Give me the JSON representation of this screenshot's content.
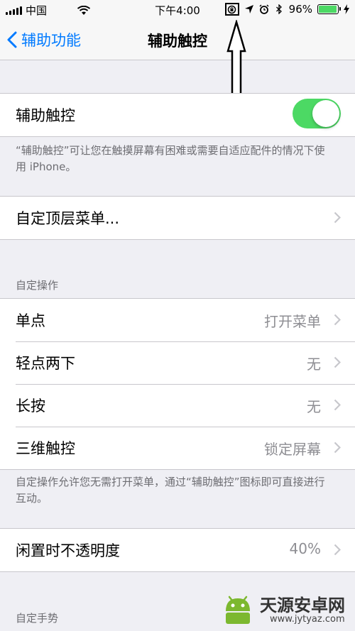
{
  "status_bar": {
    "carrier": "中国",
    "time": "下午4:00",
    "battery": "96%",
    "battery_level": 0.96,
    "battery_color": "#4cd964",
    "icons": [
      "signal-icon",
      "wifi-icon",
      "orientation-lock-icon",
      "location-icon",
      "alarm-icon",
      "bluetooth-icon",
      "battery-icon",
      "charging-icon"
    ]
  },
  "nav": {
    "back_label": "辅助功能",
    "title": "辅助触控"
  },
  "main_toggle": {
    "label": "辅助触控",
    "on": true,
    "color": "#4cd964",
    "footnote": "“辅助触控”可让您在触摸屏幕有困难或需要自适应配件的情况下使用 iPhone。"
  },
  "customize_menu": {
    "label": "自定顶层菜单..."
  },
  "custom_actions": {
    "header": "自定操作",
    "rows": [
      {
        "label": "单点",
        "value": "打开菜单"
      },
      {
        "label": "轻点两下",
        "value": "无"
      },
      {
        "label": "长按",
        "value": "无"
      },
      {
        "label": "三维触控",
        "value": "锁定屏幕"
      }
    ],
    "footnote": "自定操作允许您无需打开菜单，通过“辅助触控”图标即可直接进行互动。"
  },
  "idle_opacity": {
    "label": "闲置时不透明度",
    "value": "40%"
  },
  "custom_gestures": {
    "header": "自定手势"
  },
  "watermark": {
    "name": "天源安卓网",
    "url": "www.jytyaz.com"
  },
  "accent_color": "#007aff"
}
